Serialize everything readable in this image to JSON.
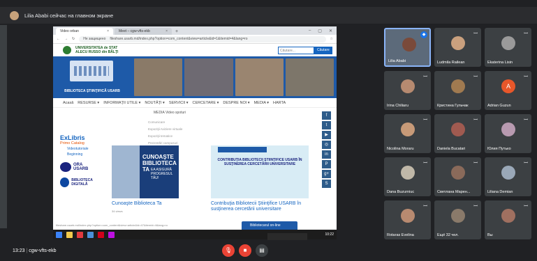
{
  "banner": {
    "text": "Lilia Ababi сейчас на главном экране"
  },
  "browser": {
    "tabs": [
      {
        "label": "Video orban",
        "close": "×"
      },
      {
        "label": "Meet – cgw-vfts-ekb",
        "close": "×"
      }
    ],
    "new_tab": "+",
    "url": "fileshare.usarb.md/index.php?option=com_content&view=article&id=1&itemid=4&lang=ro",
    "insecure": "Не защищено"
  },
  "site": {
    "university": "UNIVERSITATEA de STAT ALECU RUSSO din BĂLŢI",
    "search_placeholder": "Căutare...",
    "search_button": "Căutare",
    "library_label": "BIBLIOTECA ŞTIINŢIFICĂ USARB",
    "nav": [
      "Acasă",
      "RESURSE ▾",
      "INFORMAŢII UTILE ▾",
      "NOUTĂŢI ▾",
      "SERVICII ▾",
      "CERCETARE ▾",
      "DESPRE NOI ▾",
      "MEDIA ▾",
      "HARTA"
    ],
    "breadcrumb": "MEDIA  Video spoturi",
    "menu_items": [
      "Comunicare",
      "Expoziţii Aviziere virtuale",
      "Expoziţii tematice",
      "Prezentări campusuri",
      "Video spoturi"
    ],
    "exlibris": "ExLibris",
    "exlibris_sub": "Primo Catalog",
    "side_links": [
      "Videotutoriale",
      "Beginning"
    ],
    "ora": "ORA",
    "usarb": "USARB",
    "biblioteca_digitala": "BIBLIOTECA DIGITALĂ",
    "card1_title": "CUNOAŞTE BIBLIOTECA TA",
    "card1_sub": "EA ASIGURĂ PROGRESUL TĂU!",
    "card1_caption": "Cunoaşte Biblioteca Ta",
    "card1_views": "34 views",
    "card2_text": "CONTRIBUŢIA BIBLIOTECII ŞTIINŢIFICE USARB ÎN SUSŢINEREA CERCETĂRII UNIVERSITARE",
    "card2_caption": "Contribuţia Bibliotecii Ştiinţifice USARB în susţinerea cercetării universitare",
    "chat": "Bibliotecarul on-line",
    "status_url": "fileshare.usarb.md/index.php?option=com_content&view=article&id=47&itemid=4&lang=ro",
    "social": [
      "f",
      "t",
      "▶",
      "◎",
      "in",
      "P",
      "g+",
      "S"
    ]
  },
  "taskbar": {
    "clock": "10:22"
  },
  "participants": [
    {
      "name": "Lilia Ababi",
      "color": "#7a4a3a",
      "active": true
    },
    {
      "name": "Ludmila Railean",
      "color": "#c9a07e"
    },
    {
      "name": "Ekaterina Lisin",
      "color": "#9a9a9a"
    },
    {
      "name": "Irina Chiliaru",
      "color": "#b68a70"
    },
    {
      "name": "Кристина Гульчак",
      "color": "#a07a50"
    },
    {
      "name": "Adrian Guzun",
      "color": "#e8572a",
      "initial": "A"
    },
    {
      "name": "Nicolina Moraru",
      "color": "#c79a78"
    },
    {
      "name": "Daniela Bucatari",
      "color": "#a05a50"
    },
    {
      "name": "Юлия Путько",
      "color": "#b89ab0"
    },
    {
      "name": "Dana Buzurniuc",
      "color": "#c0b8a8"
    },
    {
      "name": "Светлана Марен...",
      "color": "#8a6a5a"
    },
    {
      "name": "Liliana Demian",
      "color": "#9aa8b8"
    },
    {
      "name": "Rotaras Evelina",
      "color": "#b88a70"
    },
    {
      "name": "Ещё 32 чел.",
      "color": "#8a7a6a"
    },
    {
      "name": "Вы",
      "color": "#a07060"
    }
  ],
  "meeting": {
    "time": "13:23",
    "code": "cgw-vfts-ekb",
    "separator": "|"
  }
}
